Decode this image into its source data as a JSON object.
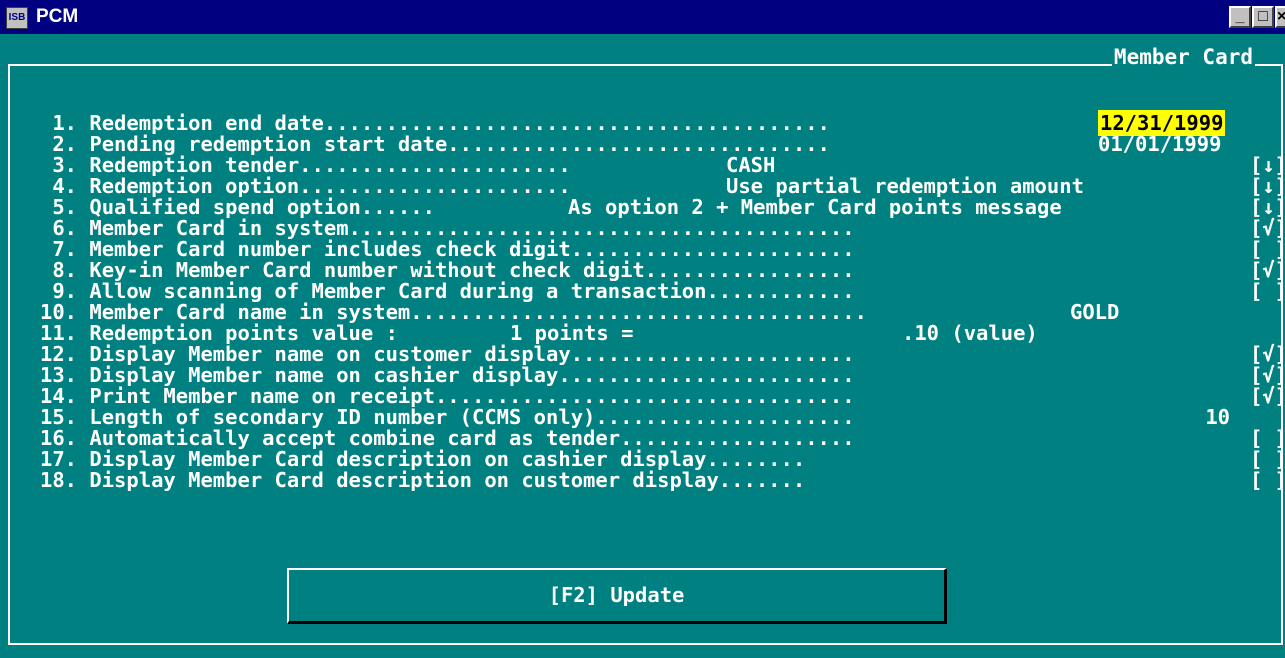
{
  "window": {
    "title": "PCM",
    "app_icon": "ISB",
    "controls": {
      "minimize": "_",
      "maximize": "□",
      "close": "×"
    }
  },
  "screen": {
    "title": "Member Card",
    "rows": [
      {
        "label": " 1. Redemption end date.........................................",
        "value": "12/31/1999"
      },
      {
        "label": " 2. Pending redemption start date...............................",
        "value": "01/01/1999"
      },
      {
        "label": " 3. Redemption tender......................",
        "value": "CASH",
        "control": "[↓]"
      },
      {
        "label": " 4. Redemption option......................",
        "value": "Use partial redemption amount",
        "control": "[↓]"
      },
      {
        "label": " 5. Qualified spend option......",
        "value": "As option 2 + Member Card points message",
        "control": "[↓]"
      },
      {
        "label": " 6. Member Card in system.........................................",
        "control": "[√]"
      },
      {
        "label": " 7. Member Card number includes check digit.......................",
        "control": "[ ]"
      },
      {
        "label": " 8. Key-in Member Card number without check digit.................",
        "control": "[√]"
      },
      {
        "label": " 9. Allow scanning of Member Card during a transaction............",
        "control": "[ ]"
      },
      {
        "label": "10. Member Card name in system.....................................",
        "value": "GOLD"
      },
      {
        "label": "11. Redemption points value :",
        "points": "1 points =",
        "amount": ".10 (value)"
      },
      {
        "label": "12. Display Member name on customer display.......................",
        "control": "[√]"
      },
      {
        "label": "13. Display Member name on cashier display........................",
        "control": "[√]"
      },
      {
        "label": "14. Print Member name on receipt..................................",
        "control": "[√]"
      },
      {
        "label": "15. Length of secondary ID number (CCMS only).....................",
        "value": "10"
      },
      {
        "label": "16. Automatically accept combine card as tender...................",
        "control": "[ ]"
      },
      {
        "label": "17. Display Member Card description on cashier display........",
        "control": "[ ]"
      },
      {
        "label": "18. Display Member Card description on customer display.......",
        "control": "[ ]"
      }
    ],
    "update_button": "[F2] Update"
  }
}
